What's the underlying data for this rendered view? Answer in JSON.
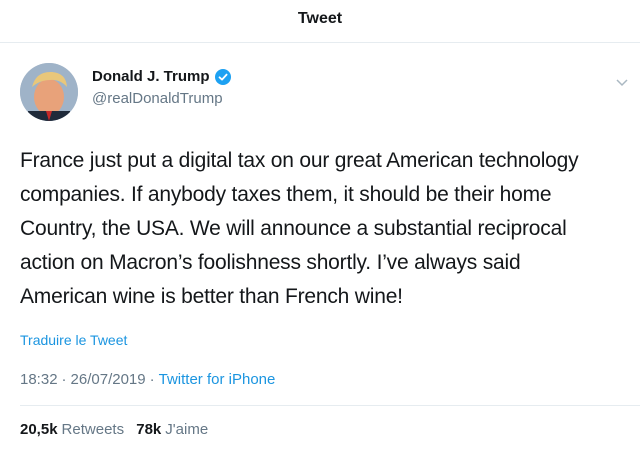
{
  "header": {
    "title": "Tweet"
  },
  "author": {
    "display_name": "Donald J. Trump",
    "handle": "@realDonaldTrump",
    "verified": true
  },
  "icons": {
    "verified": "verified-badge-icon",
    "menu": "chevron-down-icon"
  },
  "tweet": {
    "lines": [
      "France just put a digital tax on our great American technology",
      "companies. If anybody taxes them, it should be their home",
      "Country, the USA. We will announce a substantial reciprocal",
      "action on Macron’s foolishness shortly. I’ve always said",
      "American wine is better than French wine!"
    ],
    "translate_label": "Traduire le Tweet",
    "time": "18:32",
    "date": "26/07/2019",
    "source": "Twitter for iPhone",
    "separator": "·"
  },
  "stats": {
    "retweets_count": "20,5k",
    "retweets_label": "Retweets",
    "likes_count": "78k",
    "likes_label": "J'aime"
  },
  "colors": {
    "link": "#1b95e0",
    "secondary_text": "#657786",
    "primary_text": "#14171a",
    "divider": "#e6ecf0"
  }
}
